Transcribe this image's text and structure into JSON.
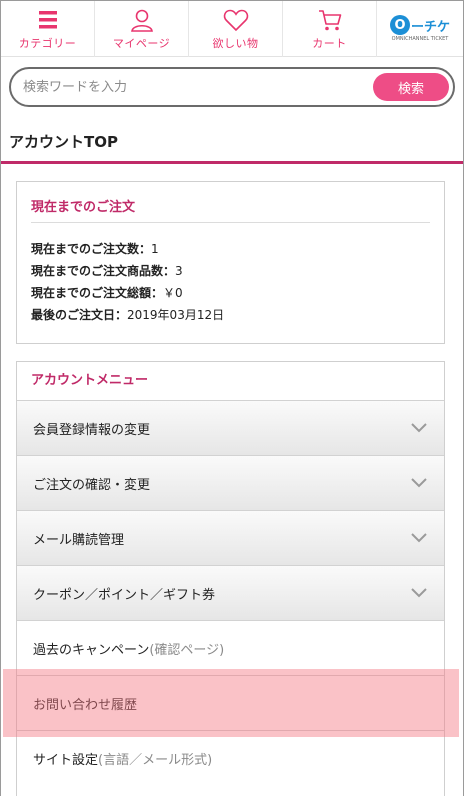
{
  "nav": {
    "category": "カテゴリー",
    "mypage": "マイページ",
    "wishlist": "欲しい物",
    "cart": "カート",
    "logo_letter": "O",
    "logo_text": "ーチケ",
    "logo_subtext": "OMNICHANNEL TICKET"
  },
  "search": {
    "placeholder": "検索ワードを入力",
    "button": "検索"
  },
  "page": {
    "title": "アカウントTOP"
  },
  "orders": {
    "title": "現在までのご注文",
    "rows": [
      {
        "label": "現在までのご注文数：",
        "value": "1"
      },
      {
        "label": "現在までのご注文商品数：",
        "value": "3"
      },
      {
        "label": "現在までのご注文総額：",
        "value": "￥0"
      },
      {
        "label": "最後のご注文日：",
        "value": "2019年03月12日"
      }
    ]
  },
  "menu": {
    "title": "アカウントメニュー",
    "items": [
      {
        "label": "会員登録情報の変更",
        "sub": ""
      },
      {
        "label": "ご注文の確認・変更",
        "sub": ""
      },
      {
        "label": "メール購読管理",
        "sub": ""
      },
      {
        "label": "クーポン／ポイント／ギフト券",
        "sub": ""
      },
      {
        "label": "過去のキャンペーン",
        "sub": "(確認ページ)"
      },
      {
        "label": "お問い合わせ履歴",
        "sub": ""
      },
      {
        "label": "サイト設定",
        "sub": "(言語／メール形式)"
      }
    ]
  },
  "colors": {
    "accent": "#e8356e",
    "heading": "#c02a68",
    "button": "#ee4d86",
    "highlight": "#f47882",
    "logo": "#1c8fd6"
  }
}
